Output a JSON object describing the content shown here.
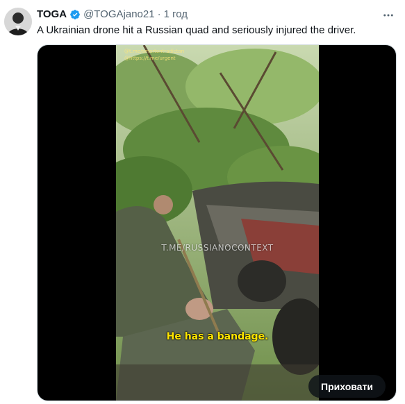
{
  "tweet": {
    "author_name": "TOGA",
    "handle": "@TOGAjano21",
    "separator": "·",
    "time": "1 год",
    "text": "A Ukrainian drone hit a Russian quad and seriously injured the driver.",
    "avatar_icon": "user-avatar-icon",
    "verified_icon": "verified-badge-icon",
    "more_icon": "more-options-icon"
  },
  "media": {
    "caption": "He has a bandage.",
    "watermark": "T.ME/RUSSIANOCONTEXT",
    "corner_links": [
      "@t.me/smartontradicton",
      "@https://t.me/urgent"
    ],
    "hide_button_label": "Приховати"
  },
  "colors": {
    "verified_blue": "#1d9bf0",
    "secondary_text": "#536471",
    "caption_yellow": "#ffe600"
  }
}
